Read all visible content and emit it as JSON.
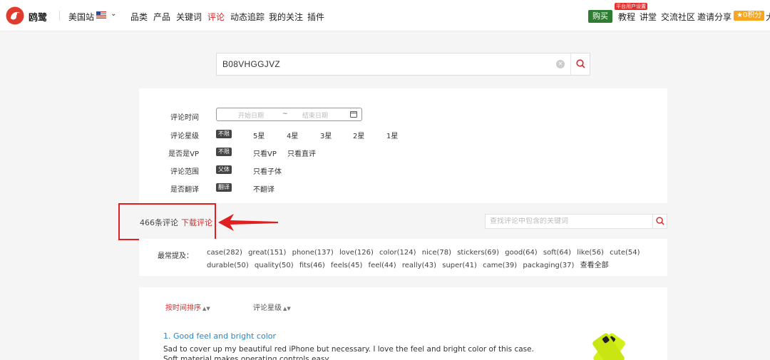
{
  "header": {
    "brand": "鸥鹭",
    "site": "美国站",
    "nav": [
      "品类",
      "产品",
      "关键词",
      "评论",
      "动态追踪",
      "我的关注",
      "插件"
    ],
    "active_nav": "评论",
    "buy": "购买",
    "promo_tag": "平台用户设置",
    "right_nav": [
      "教程",
      "讲堂",
      "交流社区",
      "邀请分享"
    ],
    "points": "0积分",
    "edge_text": "大"
  },
  "search": {
    "value": "B08VHGGJVZ"
  },
  "filters": {
    "time_label": "评论时间",
    "date_start_placeholder": "开始日期",
    "date_sep": "~",
    "date_end_placeholder": "结束日期",
    "rating": {
      "label": "评论星级",
      "selected": "不限",
      "options": [
        "5星",
        "4星",
        "3星",
        "2星",
        "1星"
      ]
    },
    "vp": {
      "label": "是否是VP",
      "selected": "不限",
      "options": [
        "只看VP",
        "只看直评"
      ]
    },
    "scope": {
      "label": "评论范围",
      "selected": "父体",
      "options": [
        "只看子体"
      ]
    },
    "translate": {
      "label": "是否翻译",
      "selected": "翻译",
      "options": [
        "不翻译"
      ]
    }
  },
  "results": {
    "count_text": "466条评论",
    "download_label": "下载评论",
    "keyword_search_placeholder": "查找评论中包含的关键词"
  },
  "mentions": {
    "title": "最常提及：",
    "line1": [
      "case(282)",
      "great(151)",
      "phone(137)",
      "love(126)",
      "color(124)",
      "nice(78)",
      "stickers(69)",
      "good(64)",
      "soft(64)",
      "like(56)",
      "cute(54)"
    ],
    "line2": [
      "durable(50)",
      "quality(50)",
      "fits(46)",
      "feels(45)",
      "feel(44)",
      "really(43)",
      "super(41)",
      "came(39)",
      "packaging(37)",
      "查看全部"
    ]
  },
  "sort": {
    "by_time": "按时间排序",
    "by_rating": "评论星级"
  },
  "review": {
    "title": "1. Good feel and bright color",
    "body": "Sad to cover up my beautiful red iPhone but necessary. I love the feel and bright color of this case. Soft material makes operating controls easy."
  },
  "colors": {
    "accent": "#d62b2b",
    "link": "#2d83c5",
    "buy": "#2f7d32",
    "points": "#f5a623",
    "highlight": "#e02020",
    "product": "#d4f01a"
  }
}
